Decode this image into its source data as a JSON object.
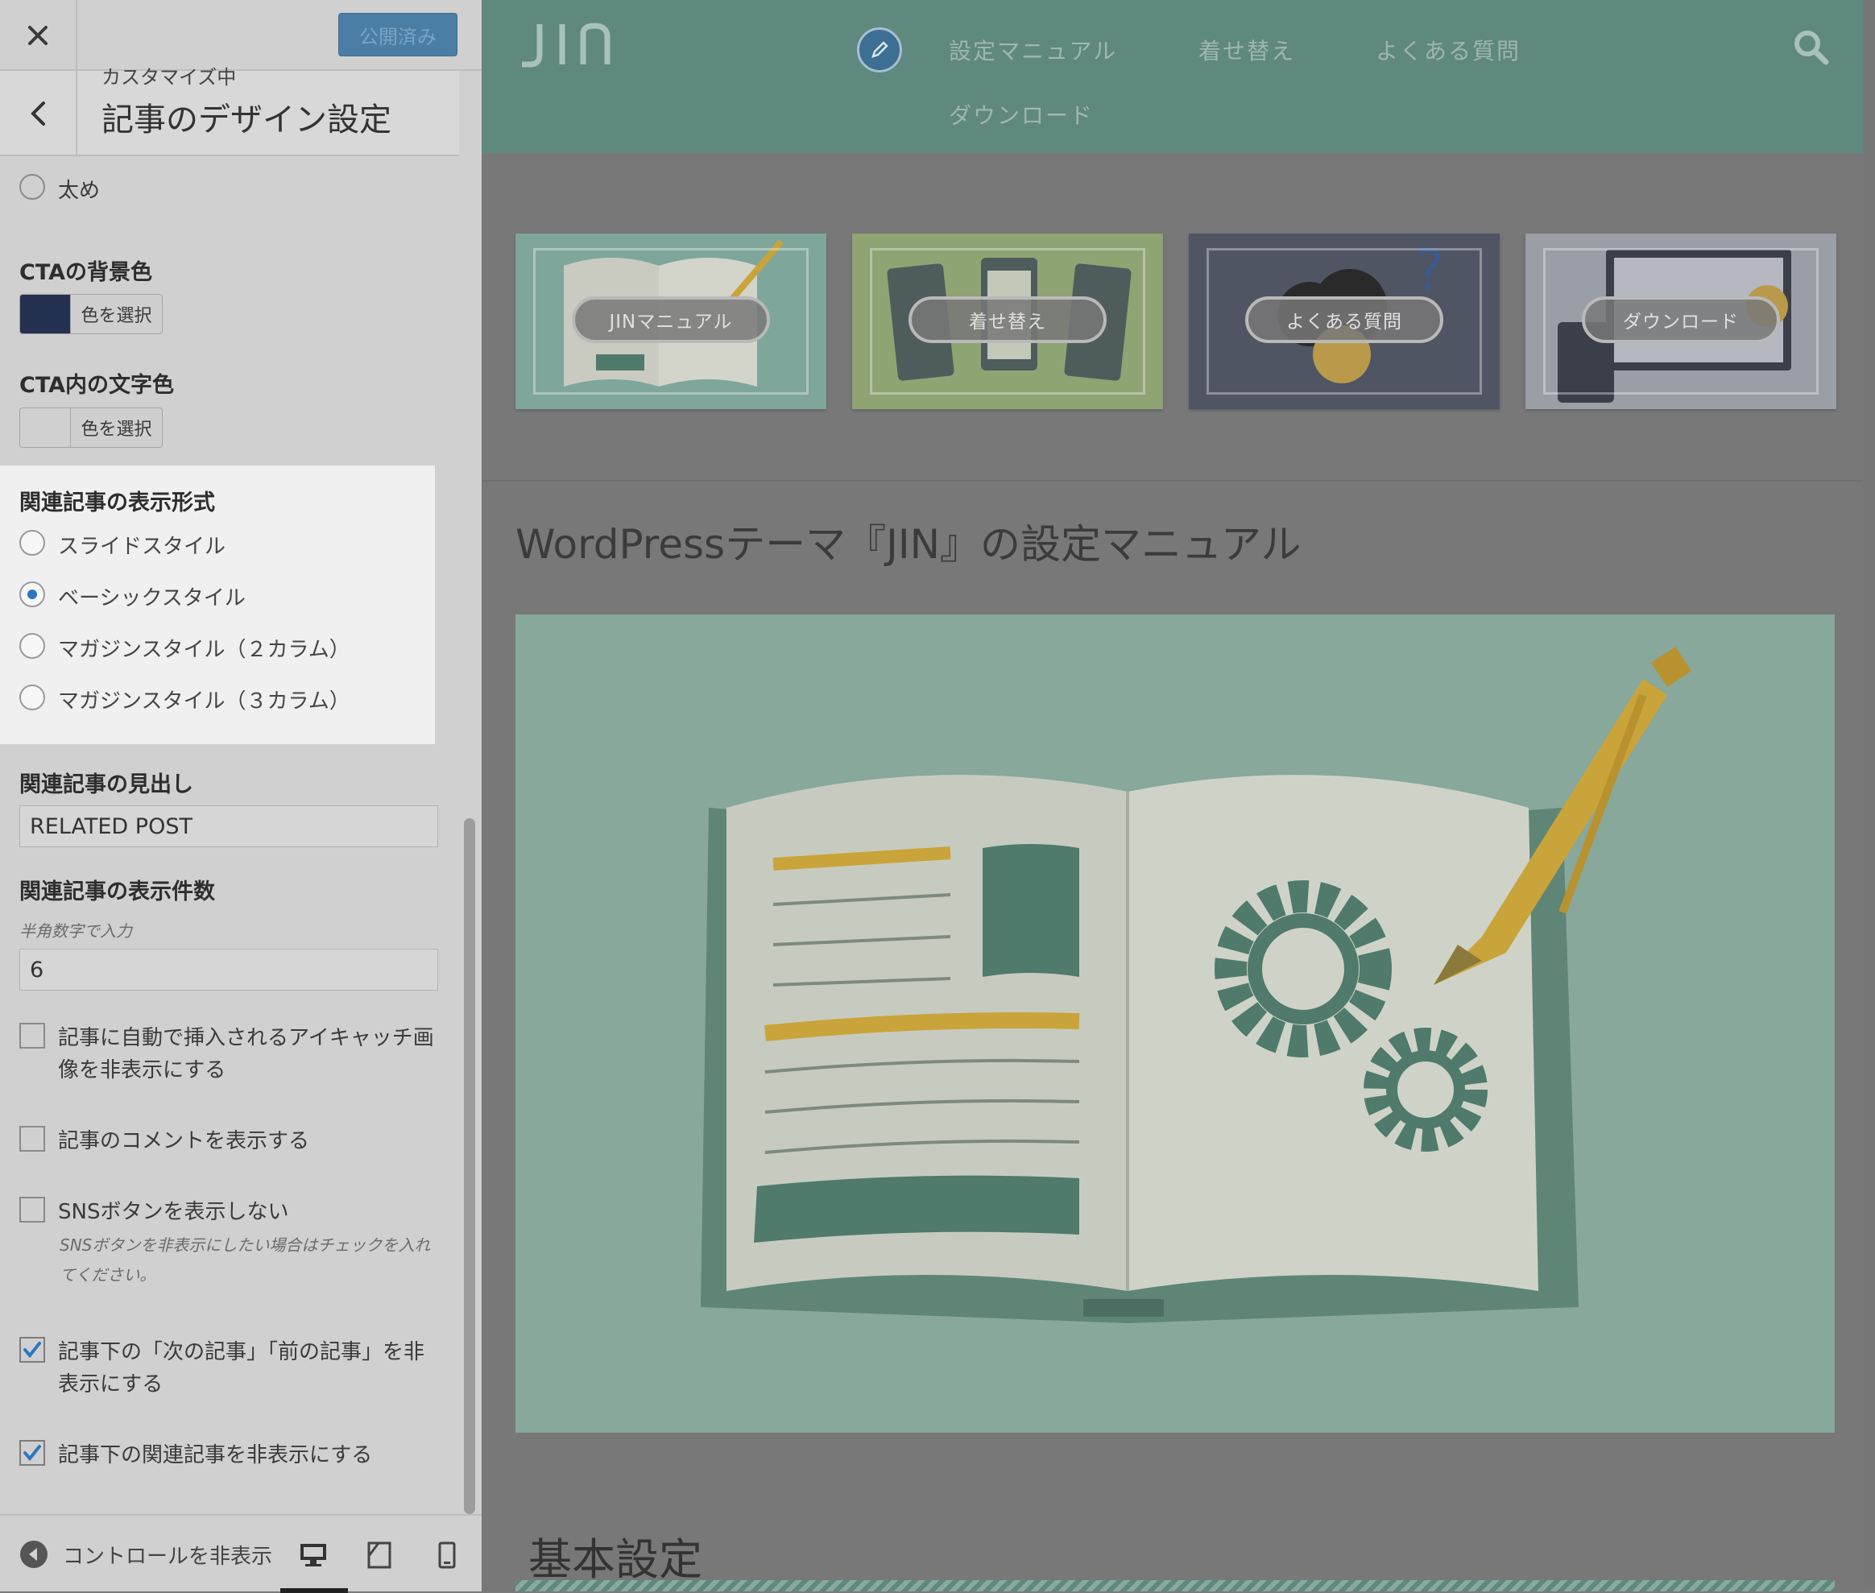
{
  "sidebar": {
    "publish_label": "公開済み",
    "breadcrumb": "カスタマイズ中",
    "title": "記事のデザイン設定",
    "font_weight_option": "太め",
    "cta_bg": {
      "heading": "CTAの背景色",
      "button": "色を選択",
      "color": "#24304f"
    },
    "cta_text": {
      "heading": "CTA内の文字色",
      "button": "色を選択",
      "color": "#d0d0d0"
    },
    "related_style": {
      "heading": "関連記事の表示形式",
      "options": [
        "スライドスタイル",
        "ベーシックスタイル",
        "マガジンスタイル（２カラム）",
        "マガジンスタイル（３カラム）"
      ],
      "selected": "ベーシックスタイル"
    },
    "related_heading": {
      "label": "関連記事の見出し",
      "value": "RELATED POST"
    },
    "related_count": {
      "label": "関連記事の表示件数",
      "hint": "半角数字で入力",
      "value": "6"
    },
    "checkboxes": {
      "hide_eyecatch": {
        "line1": "記事に自動で挿入されるアイキャッチ画",
        "line2": "像を非表示にする",
        "checked": false
      },
      "show_comments": {
        "label": "記事のコメントを表示する",
        "checked": false
      },
      "hide_sns": {
        "label": "SNSボタンを表示しない",
        "hint1": "SNSボタンを非表示にしたい場合はチェックを入れ",
        "hint2": "てください。",
        "checked": false
      },
      "hide_prev_next": {
        "line1": "記事下の「次の記事」「前の記事」を非",
        "line2": "表示にする",
        "checked": true
      },
      "hide_related": {
        "label": "記事下の関連記事を非表示にする",
        "checked": true
      }
    },
    "footer": {
      "hide_controls": "コントロールを非表示"
    }
  },
  "site": {
    "logo": "JIN",
    "nav": [
      "設定マニュアル",
      "着せ替え",
      "よくある質問",
      "ダウンロード"
    ],
    "cards": [
      {
        "label": "JINマニュアル",
        "bg": "#7fa69b"
      },
      {
        "label": "着せ替え",
        "bg": "#8ea473"
      },
      {
        "label": "よくある質問",
        "bg": "#4f5563"
      },
      {
        "label": "ダウンロード",
        "bg": "#9a9ea6"
      }
    ],
    "post_title": "WordPressテーマ『JIN』の設定マニュアル",
    "section_title": "基本設定"
  },
  "colors": {
    "accent": "#2a77c0",
    "header": "#5f887f",
    "hero": "#87a89b"
  }
}
